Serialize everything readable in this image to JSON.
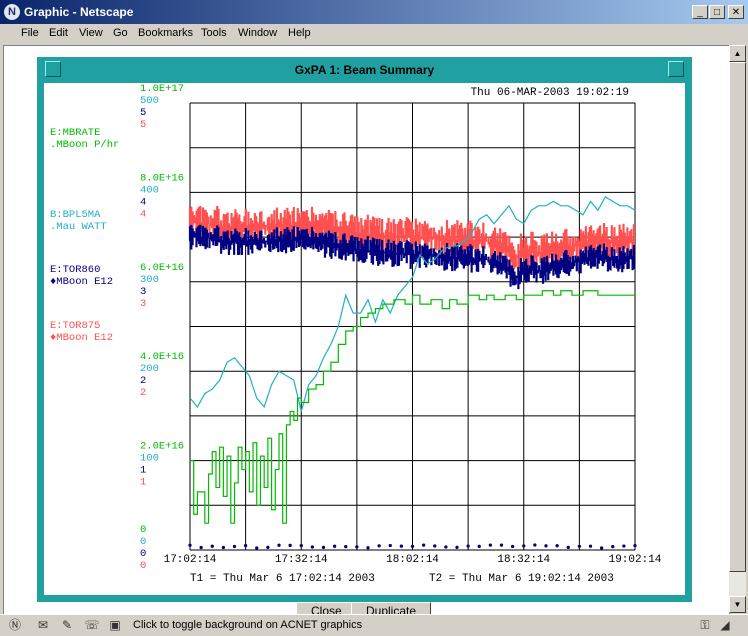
{
  "window": {
    "title": "Graphic - Netscape"
  },
  "menu": [
    "File",
    "Edit",
    "View",
    "Go",
    "Bookmarks",
    "Tools",
    "Window",
    "Help"
  ],
  "status": {
    "text": "Click to toggle background on ACNET graphics"
  },
  "graph_window": {
    "title": "GxPA 1: Beam Summary",
    "datetime": "Thu 06-MAR-2003 19:02:19"
  },
  "bottom_buttons": {
    "close": "Close",
    "duplicate": "Duplicate"
  },
  "colors": {
    "mbrate": "#00bb00",
    "bpl5ma": "#20b0c0",
    "tor860": "#000080",
    "tor875": "#ff5050",
    "grid": "#000000"
  },
  "labels": {
    "mbrate": [
      "E:MBRATE",
      ".MBoon  P/hr"
    ],
    "bpl5ma": [
      "B:BPL5MA",
      ".Mau    WATT"
    ],
    "tor860": [
      "E:TOR860",
      "♦MBoon  E12"
    ],
    "tor875": [
      "E:TOR875",
      "♦MBoon  E12"
    ]
  },
  "chart_data": {
    "type": "line",
    "x_ticks": [
      "17:02:14",
      "17:32:14",
      "18:02:14",
      "18:32:14",
      "19:02:14"
    ],
    "t1": "T1 = Thu Mar  6 17:02:14 2003",
    "t2": "T2 = Thu Mar  6 19:02:14 2003",
    "xlim_minutes": [
      0,
      120
    ],
    "y_axes": [
      {
        "name": "E:MBRATE",
        "ticks": [
          "0",
          "2.0E+16",
          "4.0E+16",
          "6.0E+16",
          "8.0E+16",
          "1.0E+17"
        ],
        "color": "#00bb00"
      },
      {
        "name": "B:BPL5MA",
        "ticks": [
          "0",
          "100",
          "200",
          "300",
          "400",
          "500"
        ],
        "color": "#20b0c0"
      },
      {
        "name": "E:TOR860",
        "ticks": [
          "0",
          "1",
          "2",
          "3",
          "4",
          "5"
        ],
        "color": "#000080"
      },
      {
        "name": "E:TOR875",
        "ticks": [
          "0",
          "1",
          "2",
          "3",
          "4",
          "5"
        ],
        "color": "#ff5050"
      }
    ],
    "series": [
      {
        "name": "E:MBRATE",
        "color": "#00bb00",
        "style": "step",
        "x": [
          0,
          1,
          2,
          4,
          5,
          6,
          7,
          8,
          9,
          10,
          11,
          12,
          13,
          14,
          15,
          16,
          17,
          18,
          19,
          20,
          21,
          22,
          23,
          24,
          25,
          26,
          27,
          28,
          29,
          30,
          32,
          34,
          36,
          38,
          40,
          42,
          44,
          46,
          48,
          50,
          52,
          55,
          58,
          60,
          62,
          65,
          68,
          70,
          72,
          75,
          78,
          80,
          82,
          85,
          88,
          90,
          92,
          95,
          98,
          100,
          103,
          106,
          110,
          115,
          120
        ],
        "y": [
          2e+16,
          8000000000000000.0,
          1.3e+16,
          6000000000000000.0,
          1.7e+16,
          2.2e+16,
          1.4e+16,
          2.3e+16,
          1.2e+16,
          2.1e+16,
          6000000000000000.0,
          1.5e+16,
          2.3e+16,
          1.8e+16,
          2.2e+16,
          1.3e+16,
          2.4e+16,
          1e+16,
          2.1e+16,
          1.4e+16,
          2.5e+16,
          9000000000000000.0,
          1.8e+16,
          2.6e+16,
          6000000000000000.0,
          2.8e+16,
          3.1e+16,
          2.9e+16,
          3.4e+16,
          3.3e+16,
          3.6e+16,
          3.7e+16,
          4e+16,
          4.2e+16,
          4.6e+16,
          4.9e+16,
          5e+16,
          5.2e+16,
          5.3e+16,
          5.4e+16,
          5.5e+16,
          5.6e+16,
          5.5e+16,
          5.7e+16,
          5.5e+16,
          5.6e+16,
          5.4e+16,
          5.6e+16,
          5.5e+16,
          5.7e+16,
          5.6e+16,
          5.7e+16,
          5.6e+16,
          5.7e+16,
          5.6e+16,
          5.7e+16,
          5.7e+16,
          5.8e+16,
          5.7e+16,
          5.8e+16,
          5.7e+16,
          5.8e+16,
          5.7e+16,
          5.7e+16,
          5.7e+16
        ]
      },
      {
        "name": "B:BPL5MA",
        "color": "#20b0c0",
        "style": "line",
        "x": [
          0,
          2,
          4,
          6,
          8,
          10,
          12,
          14,
          16,
          18,
          20,
          22,
          24,
          26,
          28,
          30,
          32,
          34,
          36,
          38,
          40,
          42,
          44,
          46,
          48,
          50,
          52,
          54,
          56,
          58,
          60,
          62,
          64,
          66,
          68,
          70,
          72,
          74,
          76,
          78,
          80,
          82,
          84,
          86,
          88,
          90,
          92,
          94,
          96,
          98,
          100,
          102,
          104,
          106,
          108,
          110,
          112,
          114,
          116,
          118,
          120
        ],
        "y": [
          170,
          160,
          175,
          180,
          190,
          210,
          215,
          205,
          195,
          170,
          160,
          185,
          200,
          195,
          190,
          155,
          185,
          195,
          215,
          230,
          250,
          285,
          265,
          265,
          280,
          255,
          280,
          265,
          285,
          295,
          305,
          330,
          320,
          325,
          335,
          340,
          340,
          345,
          355,
          370,
          375,
          365,
          375,
          385,
          370,
          365,
          380,
          385,
          385,
          390,
          385,
          385,
          380,
          375,
          390,
          380,
          395,
          390,
          385,
          385,
          380
        ]
      },
      {
        "name": "E:TOR860",
        "color": "#000080",
        "style": "band",
        "x": [
          0,
          10,
          20,
          30,
          40,
          50,
          60,
          70,
          80,
          85,
          88,
          90,
          95,
          100,
          105,
          110,
          115,
          120
        ],
        "y": [
          3.52,
          3.46,
          3.45,
          3.48,
          3.4,
          3.34,
          3.3,
          3.28,
          3.25,
          3.15,
          3.05,
          3.15,
          3.12,
          3.2,
          3.22,
          3.3,
          3.22,
          3.28
        ]
      },
      {
        "name": "E:TOR875",
        "color": "#ff5050",
        "style": "band",
        "x": [
          0,
          10,
          20,
          30,
          40,
          50,
          60,
          70,
          80,
          85,
          88,
          90,
          95,
          100,
          105,
          110,
          115,
          120
        ],
        "y": [
          3.68,
          3.62,
          3.62,
          3.64,
          3.58,
          3.52,
          3.5,
          3.48,
          3.46,
          3.36,
          3.28,
          3.36,
          3.32,
          3.38,
          3.4,
          3.46,
          3.42,
          3.46
        ]
      }
    ]
  }
}
